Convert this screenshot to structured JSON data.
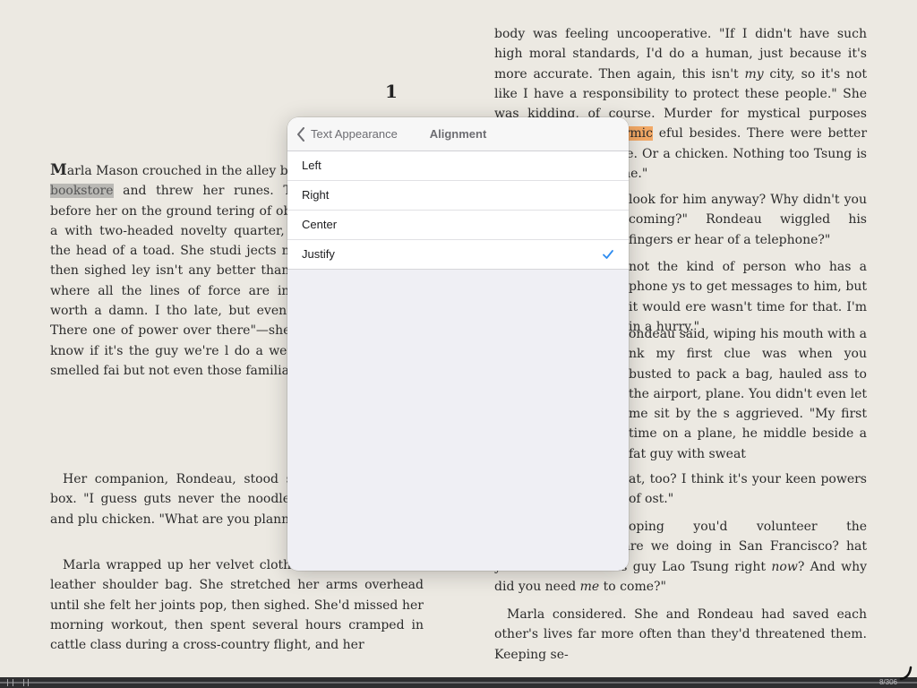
{
  "chapter_number": "1",
  "left_page": {
    "p1": {
      "dropcap": "M",
      "before": "arla Mason crouched in the alley be",
      "highlight": "bookstore",
      "after": " and threw her runes. The s velvet spread before her on the ground tering of objects—a garlic clove, a with two-headed novelty quarter, fingerna stone from the head of a toad. She studi jects made for a long time, then sighed ley isn't any better than the other two know where all the lines of force are in terpret the scatter worth a damn. I tho late, but even then it's too vague. There one of power over there\"—she gesture \"but I don't know if it's the guy we're l do a wet divination.\" The air smelled fai but not even those familiar urban smell"
    },
    "p2": "Her companion, Rondeau, stood slurp a waxed-paper box. \"I guess guts never the noodles with his chopstick and plu chicken. \"What are you planning to evis",
    "p3": "Marla wrapped up her velvet cloth a stowed them in a leather shoulder bag. She stretched her arms overhead until she felt her joints pop, then sighed. She'd missed her morning workout, then spent several hours cramped in cattle class during a cross-country flight, and her"
  },
  "right_page": {
    "p1": {
      "a": "body was feeling uncooperative. \"If I didn't have such high moral standards, I'd do a human, just because it's more accurate. Then again, this isn't ",
      "em1": "my",
      "b": " city, so it's not like I have a responsibility to protect these people.\" She was kidding, of course. Murder for mystical purposes incurred a nasty ",
      "highlight": "karmic",
      "c": " eful besides. There were better uses for A cat, maybe. Or a chicken. Nothing too Tsung is trying to hide from me.\""
    },
    "p2": "look for him anyway? Why didn't you coming?\" Rondeau wiggled his fingers er hear of a telephone?\"",
    "p3": "not the kind of person who has a phone ys to get messages to him, but it would ere wasn't time for that. I'm in a hurry.\"",
    "p4": "ondeau said, wiping his mouth with a nk my first clue was when you busted to pack a bag, hauled ass to the airport, plane. You didn't even let me sit by the s aggrieved. \"My first time on a plane, he middle beside a fat guy with sweat",
    "p5": "at, too? I think it's your keen powers of ost.\"",
    "p6": {
      "a": "oping you'd volunteer the information, -what are we doing in San Francisco? hat you have to see this guy Lao Tsung right ",
      "em1": "now",
      "b": "? And why did you need ",
      "em2": "me",
      "c": " to come?\""
    },
    "p7": "Marla considered. She and Rondeau had saved each other's lives far more often than they'd threatened them. Keeping se-"
  },
  "popover": {
    "back_label": "Text Appearance",
    "title": "Alignment",
    "options": [
      {
        "label": "Left",
        "selected": false
      },
      {
        "label": "Right",
        "selected": false
      },
      {
        "label": "Center",
        "selected": false
      },
      {
        "label": "Justify",
        "selected": true
      }
    ],
    "accent_color": "#2f8cf0"
  },
  "scrubber": {
    "page_indicator": "8/306"
  },
  "colors": {
    "page_background": "#ece9e2",
    "highlight_gray": "#b9b8b4",
    "highlight_orange": "#f2a865"
  }
}
